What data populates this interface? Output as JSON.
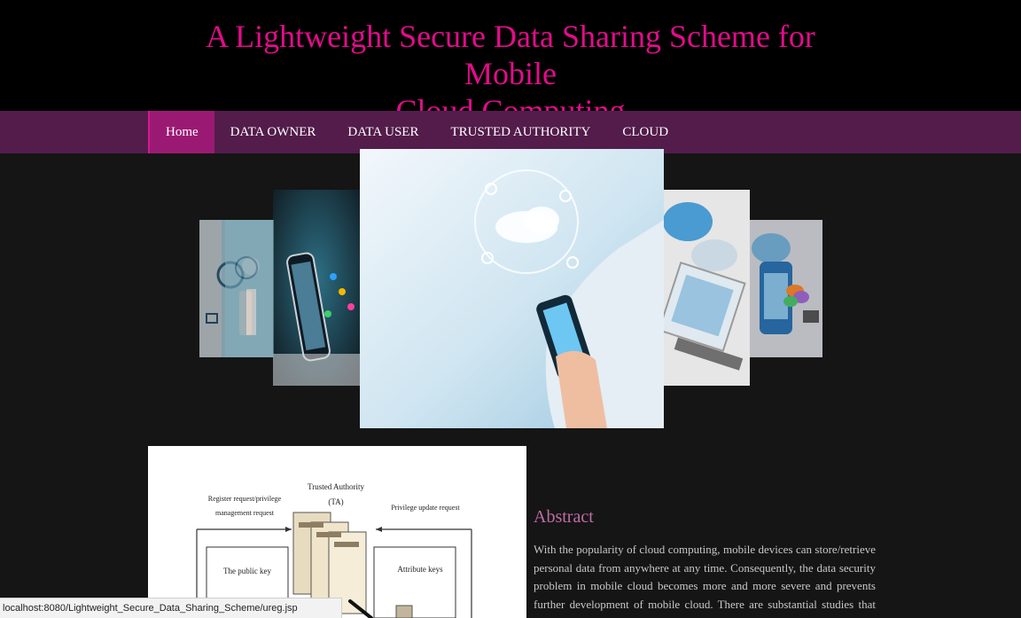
{
  "header": {
    "title_line1": "A Lightweight Secure Data Sharing Scheme for Mobile",
    "title_line2": "Cloud Computing"
  },
  "nav": {
    "items": [
      {
        "label": "Home",
        "active": true
      },
      {
        "label": "DATA OWNER",
        "active": false
      },
      {
        "label": "DATA USER",
        "active": false
      },
      {
        "label": "TRUSTED AUTHORITY",
        "active": false
      },
      {
        "label": "CLOUD",
        "active": false
      }
    ]
  },
  "slider": {
    "slides": [
      "cloud-brain-slide",
      "smartphone-apps-slide",
      "hand-phone-cloud-slide",
      "cloud-laptop-slide",
      "mobile-cloud-slide"
    ]
  },
  "diagram": {
    "ta_label": "Trusted Authority",
    "ta_abbrev": "(TA)",
    "left_request": "Register request/privilege\nmanagement request",
    "right_request": "Privilege update request",
    "public_key": "The public key",
    "attribute_keys": "Attribute keys"
  },
  "abstract": {
    "title": "Abstract",
    "text": "With the popularity of cloud computing, mobile devices can store/retrieve personal data from anywhere at any time. Consequently, the data security problem in mobile cloud becomes more and more severe and prevents further development of mobile cloud. There are substantial studies that have been"
  },
  "status_bar": {
    "url": "localhost:8080/Lightweight_Secure_Data_Sharing_Scheme/ureg.jsp"
  },
  "colors": {
    "title": "#e20c8a",
    "navbar": "#531c4b",
    "nav_active": "#9a1a73",
    "abstract_title": "#c06ca8"
  }
}
